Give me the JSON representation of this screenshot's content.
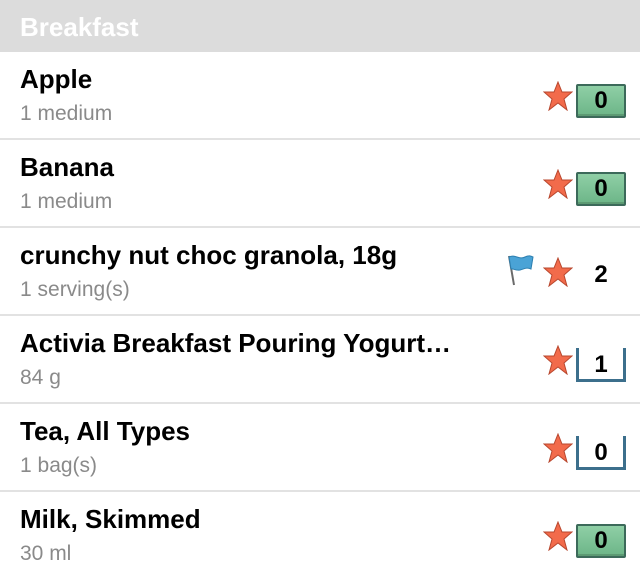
{
  "section": {
    "title": "Breakfast"
  },
  "colors": {
    "star": "#f26b4b",
    "filled_box": "#7cc196",
    "outlined_box": "#3c6f8c",
    "flag": "#4aa3d6"
  },
  "items": [
    {
      "name": "Apple",
      "serving": "1 medium",
      "count": "0",
      "count_style": "filled",
      "flag": false
    },
    {
      "name": "Banana",
      "serving": "1 medium",
      "count": "0",
      "count_style": "filled",
      "flag": false
    },
    {
      "name": "crunchy nut choc granola, 18g",
      "serving": "1 serving(s)",
      "count": "2",
      "count_style": "plain",
      "flag": true
    },
    {
      "name": "Activia Breakfast Pouring Yogurt…",
      "serving": "84 g",
      "count": "1",
      "count_style": "outlined",
      "flag": false
    },
    {
      "name": "Tea, All Types",
      "serving": "1 bag(s)",
      "count": "0",
      "count_style": "outlined",
      "flag": false
    },
    {
      "name": "Milk, Skimmed",
      "serving": "30 ml",
      "count": "0",
      "count_style": "filled",
      "flag": false
    }
  ]
}
